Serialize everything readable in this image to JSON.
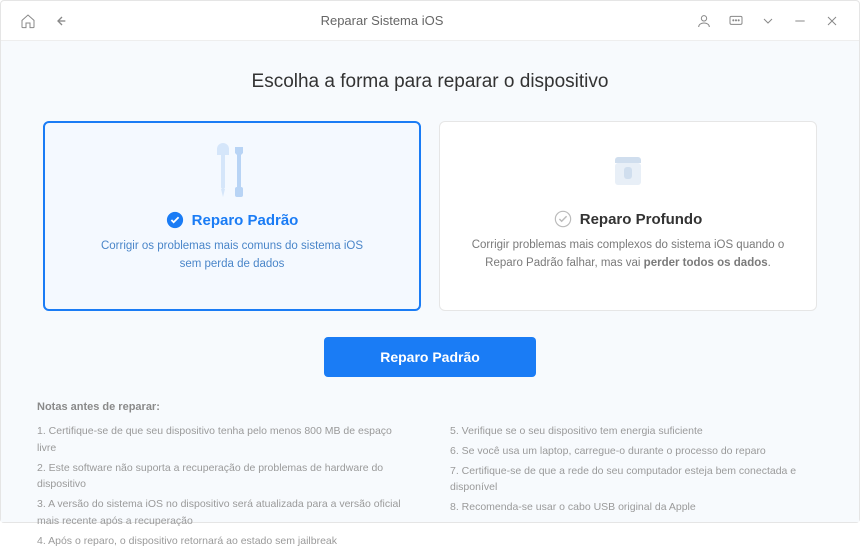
{
  "titlebar": {
    "title": "Reparar Sistema iOS"
  },
  "heading": "Escolha a forma para reparar o dispositivo",
  "cards": {
    "standard": {
      "title": "Reparo Padrão",
      "desc1": "Corrigir os problemas mais comuns do sistema iOS",
      "desc2": "sem perda de dados"
    },
    "deep": {
      "title": "Reparo Profundo",
      "desc1": "Corrigir problemas mais complexos do sistema iOS quando o Reparo Padrão falhar, mas vai ",
      "desc2_bold": "perder todos os dados",
      "desc3": "."
    }
  },
  "button": {
    "label": "Reparo Padrão"
  },
  "notes": {
    "title": "Notas antes de reparar:",
    "left": [
      "1.  Certifique-se de que seu dispositivo tenha pelo menos 800 MB de espaço livre",
      "2.  Este software não suporta a recuperação de problemas de hardware do dispositivo",
      "3.  A versão do sistema iOS no dispositivo será atualizada para a versão oficial mais recente após a recuperação",
      "4.  Após o reparo, o dispositivo retornará ao estado sem jailbreak"
    ],
    "right": [
      "5.  Verifique se o seu dispositivo tem energia suficiente",
      "6.  Se você usa um laptop, carregue-o durante o processo do reparo",
      "7.  Certifique-se de que a rede do seu computador esteja bem conectada e disponível",
      "8.  Recomenda-se usar o cabo USB original da Apple"
    ]
  }
}
